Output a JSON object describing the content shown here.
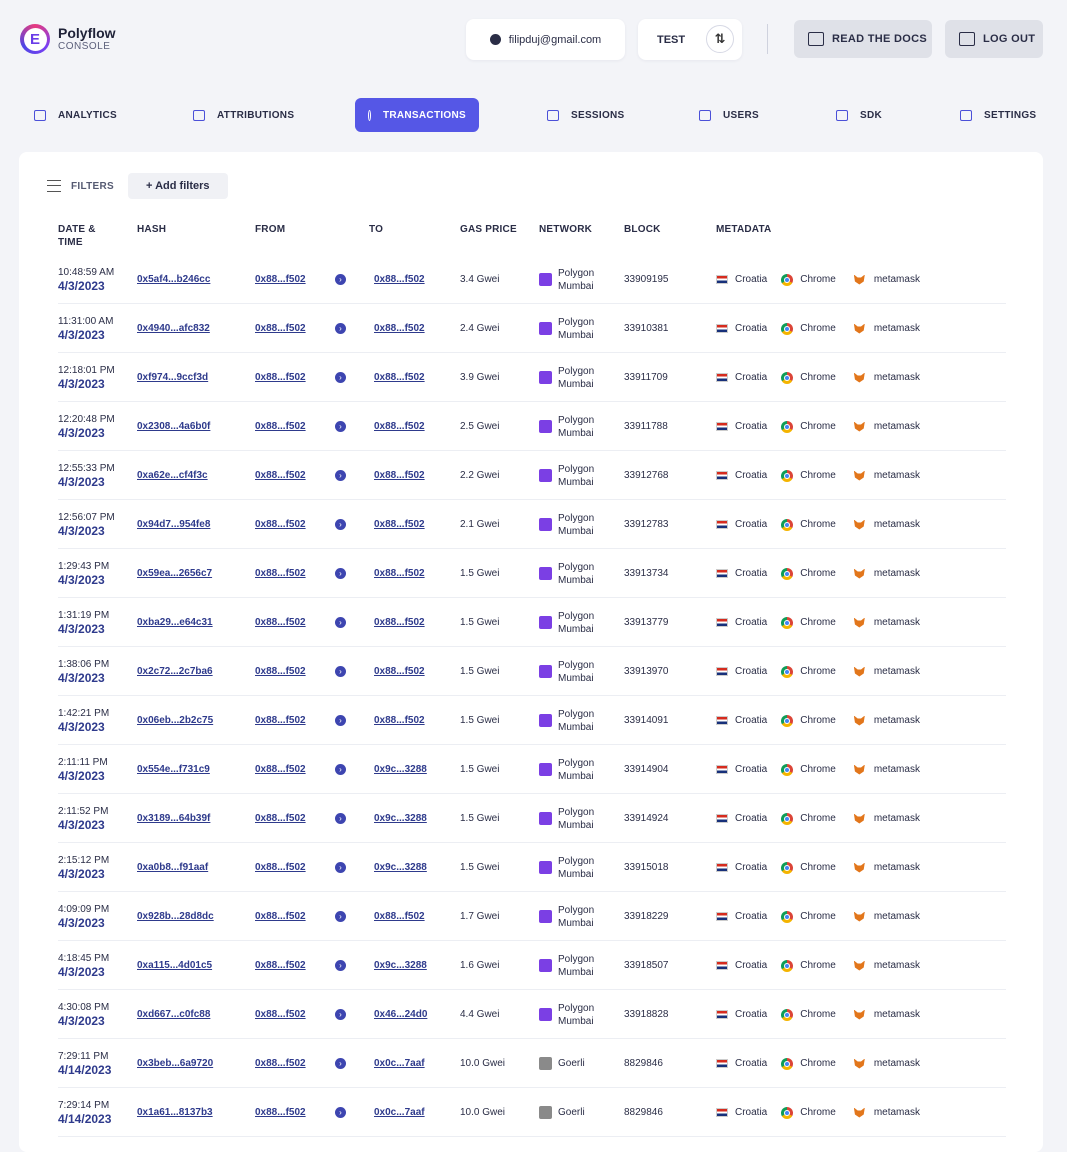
{
  "brand": {
    "name": "Polyflow",
    "sub": "CONSOLE"
  },
  "header": {
    "email": "filipduj@gmail.com",
    "env": "TEST",
    "docs_label": "READ THE DOCS",
    "logout_label": "LOG OUT"
  },
  "nav": [
    {
      "label": "ANALYTICS"
    },
    {
      "label": "ATTRIBUTIONS"
    },
    {
      "label": "TRANSACTIONS"
    },
    {
      "label": "SESSIONS"
    },
    {
      "label": "USERS"
    },
    {
      "label": "SDK"
    },
    {
      "label": "SETTINGS"
    }
  ],
  "filters": {
    "label": "FILTERS",
    "add_label": "+ Add filters"
  },
  "columns": {
    "date": "DATE & TIME",
    "hash": "HASH",
    "from": "FROM",
    "to": "TO",
    "gas": "GAS PRICE",
    "network": "NETWORK",
    "block": "BLOCK",
    "metadata": "METADATA"
  },
  "rows": [
    {
      "time": "10:48:59 AM",
      "date": "4/3/2023",
      "hash": "0x5af4...b246cc",
      "from": "0x88...f502",
      "to": "0x88...f502",
      "gas": "3.4 Gwei",
      "network": [
        "Polygon",
        "Mumbai"
      ],
      "block": "33909195",
      "country": "Croatia",
      "browser": "Chrome",
      "wallet": "metamask"
    },
    {
      "time": "11:31:00 AM",
      "date": "4/3/2023",
      "hash": "0x4940...afc832",
      "from": "0x88...f502",
      "to": "0x88...f502",
      "gas": "2.4 Gwei",
      "network": [
        "Polygon",
        "Mumbai"
      ],
      "block": "33910381",
      "country": "Croatia",
      "browser": "Chrome",
      "wallet": "metamask"
    },
    {
      "time": "12:18:01 PM",
      "date": "4/3/2023",
      "hash": "0xf974...9ccf3d",
      "from": "0x88...f502",
      "to": "0x88...f502",
      "gas": "3.9 Gwei",
      "network": [
        "Polygon",
        "Mumbai"
      ],
      "block": "33911709",
      "country": "Croatia",
      "browser": "Chrome",
      "wallet": "metamask"
    },
    {
      "time": "12:20:48 PM",
      "date": "4/3/2023",
      "hash": "0x2308...4a6b0f",
      "from": "0x88...f502",
      "to": "0x88...f502",
      "gas": "2.5 Gwei",
      "network": [
        "Polygon",
        "Mumbai"
      ],
      "block": "33911788",
      "country": "Croatia",
      "browser": "Chrome",
      "wallet": "metamask"
    },
    {
      "time": "12:55:33 PM",
      "date": "4/3/2023",
      "hash": "0xa62e...cf4f3c",
      "from": "0x88...f502",
      "to": "0x88...f502",
      "gas": "2.2 Gwei",
      "network": [
        "Polygon",
        "Mumbai"
      ],
      "block": "33912768",
      "country": "Croatia",
      "browser": "Chrome",
      "wallet": "metamask"
    },
    {
      "time": "12:56:07 PM",
      "date": "4/3/2023",
      "hash": "0x94d7...954fe8",
      "from": "0x88...f502",
      "to": "0x88...f502",
      "gas": "2.1 Gwei",
      "network": [
        "Polygon",
        "Mumbai"
      ],
      "block": "33912783",
      "country": "Croatia",
      "browser": "Chrome",
      "wallet": "metamask"
    },
    {
      "time": "1:29:43 PM",
      "date": "4/3/2023",
      "hash": "0x59ea...2656c7",
      "from": "0x88...f502",
      "to": "0x88...f502",
      "gas": "1.5 Gwei",
      "network": [
        "Polygon",
        "Mumbai"
      ],
      "block": "33913734",
      "country": "Croatia",
      "browser": "Chrome",
      "wallet": "metamask"
    },
    {
      "time": "1:31:19 PM",
      "date": "4/3/2023",
      "hash": "0xba29...e64c31",
      "from": "0x88...f502",
      "to": "0x88...f502",
      "gas": "1.5 Gwei",
      "network": [
        "Polygon",
        "Mumbai"
      ],
      "block": "33913779",
      "country": "Croatia",
      "browser": "Chrome",
      "wallet": "metamask"
    },
    {
      "time": "1:38:06 PM",
      "date": "4/3/2023",
      "hash": "0x2c72...2c7ba6",
      "from": "0x88...f502",
      "to": "0x88...f502",
      "gas": "1.5 Gwei",
      "network": [
        "Polygon",
        "Mumbai"
      ],
      "block": "33913970",
      "country": "Croatia",
      "browser": "Chrome",
      "wallet": "metamask"
    },
    {
      "time": "1:42:21 PM",
      "date": "4/3/2023",
      "hash": "0x06eb...2b2c75",
      "from": "0x88...f502",
      "to": "0x88...f502",
      "gas": "1.5 Gwei",
      "network": [
        "Polygon",
        "Mumbai"
      ],
      "block": "33914091",
      "country": "Croatia",
      "browser": "Chrome",
      "wallet": "metamask"
    },
    {
      "time": "2:11:11 PM",
      "date": "4/3/2023",
      "hash": "0x554e...f731c9",
      "from": "0x88...f502",
      "to": "0x9c...3288",
      "gas": "1.5 Gwei",
      "network": [
        "Polygon",
        "Mumbai"
      ],
      "block": "33914904",
      "country": "Croatia",
      "browser": "Chrome",
      "wallet": "metamask"
    },
    {
      "time": "2:11:52 PM",
      "date": "4/3/2023",
      "hash": "0x3189...64b39f",
      "from": "0x88...f502",
      "to": "0x9c...3288",
      "gas": "1.5 Gwei",
      "network": [
        "Polygon",
        "Mumbai"
      ],
      "block": "33914924",
      "country": "Croatia",
      "browser": "Chrome",
      "wallet": "metamask"
    },
    {
      "time": "2:15:12 PM",
      "date": "4/3/2023",
      "hash": "0xa0b8...f91aaf",
      "from": "0x88...f502",
      "to": "0x9c...3288",
      "gas": "1.5 Gwei",
      "network": [
        "Polygon",
        "Mumbai"
      ],
      "block": "33915018",
      "country": "Croatia",
      "browser": "Chrome",
      "wallet": "metamask"
    },
    {
      "time": "4:09:09 PM",
      "date": "4/3/2023",
      "hash": "0x928b...28d8dc",
      "from": "0x88...f502",
      "to": "0x88...f502",
      "gas": "1.7 Gwei",
      "network": [
        "Polygon",
        "Mumbai"
      ],
      "block": "33918229",
      "country": "Croatia",
      "browser": "Chrome",
      "wallet": "metamask"
    },
    {
      "time": "4:18:45 PM",
      "date": "4/3/2023",
      "hash": "0xa115...4d01c5",
      "from": "0x88...f502",
      "to": "0x9c...3288",
      "gas": "1.6 Gwei",
      "network": [
        "Polygon",
        "Mumbai"
      ],
      "block": "33918507",
      "country": "Croatia",
      "browser": "Chrome",
      "wallet": "metamask"
    },
    {
      "time": "4:30:08 PM",
      "date": "4/3/2023",
      "hash": "0xd667...c0fc88",
      "from": "0x88...f502",
      "to": "0x46...24d0",
      "gas": "4.4 Gwei",
      "network": [
        "Polygon",
        "Mumbai"
      ],
      "block": "33918828",
      "country": "Croatia",
      "browser": "Chrome",
      "wallet": "metamask"
    },
    {
      "time": "7:29:11 PM",
      "date": "4/14/2023",
      "hash": "0x3beb...6a9720",
      "from": "0x88...f502",
      "to": "0x0c...7aaf",
      "gas": "10.0 Gwei",
      "network": [
        "Goerli"
      ],
      "block": "8829846",
      "country": "Croatia",
      "browser": "Chrome",
      "wallet": "metamask"
    },
    {
      "time": "7:29:14 PM",
      "date": "4/14/2023",
      "hash": "0x1a61...8137b3",
      "from": "0x88...f502",
      "to": "0x0c...7aaf",
      "gas": "10.0 Gwei",
      "network": [
        "Goerli"
      ],
      "block": "8829846",
      "country": "Croatia",
      "browser": "Chrome",
      "wallet": "metamask"
    }
  ]
}
